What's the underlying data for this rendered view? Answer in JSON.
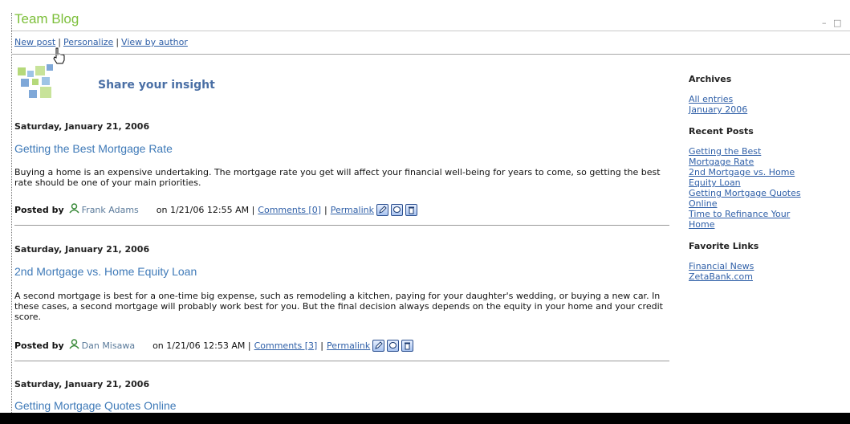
{
  "header": {
    "title": "Team Blog",
    "minimize_glyph": "–",
    "maximize_glyph": "□"
  },
  "toolbar": {
    "new_post": "New post",
    "sep1": "|",
    "personalize": "Personalize",
    "sep2": "|",
    "view_by_author": "View by author"
  },
  "hero": {
    "title": "Share your insight",
    "logo_icon": "tiles-logo-icon"
  },
  "posts": [
    {
      "date": "Saturday, January 21, 2006",
      "title": "Getting the Best Mortgage Rate",
      "body": "Buying a home is an expensive undertaking. The mortgage rate you get will affect your financial well-being for years to come, so getting the best rate should be one of your main priorities.",
      "posted_by": "Posted by",
      "author": "Frank Adams",
      "timestamp": "on 1/21/06 12:55 AM |",
      "comments": "Comments [0]",
      "sep": "|",
      "permalink": "Permalink"
    },
    {
      "date": "Saturday, January 21, 2006",
      "title": "2nd Mortgage vs. Home Equity Loan",
      "body": "A second mortgage is best for a one-time big expense, such as remodeling a kitchen, paying for your daughter's wedding, or buying a new car. In these cases, a second mortgage will probably work best for you. But the final decision always depends on the equity in your home and your credit score.",
      "posted_by": "Posted by",
      "author": "Dan Misawa",
      "timestamp": "on 1/21/06 12:53 AM |",
      "comments": "Comments [3]",
      "sep": "|",
      "permalink": "Permalink"
    },
    {
      "date": "Saturday, January 21, 2006",
      "title": "Getting Mortgage Quotes Online"
    }
  ],
  "sidebar": {
    "archives": {
      "heading": "Archives",
      "links": [
        "All entries",
        "January 2006"
      ]
    },
    "recent": {
      "heading": "Recent Posts",
      "links": [
        "Getting the Best",
        "Mortgage Rate",
        "2nd Mortgage vs. Home",
        "Equity Loan",
        "Getting Mortgage Quotes",
        "Online",
        "Time to Refinance Your",
        "Home"
      ]
    },
    "favorites": {
      "heading": "Favorite Links",
      "links": [
        "Financial News",
        "ZetaBank.com"
      ]
    }
  },
  "colors": {
    "title_green": "#7cbf3a",
    "link_blue": "#3060a8",
    "post_title_blue": "#3f7ab8",
    "hero_blue": "#4a6fa5"
  }
}
